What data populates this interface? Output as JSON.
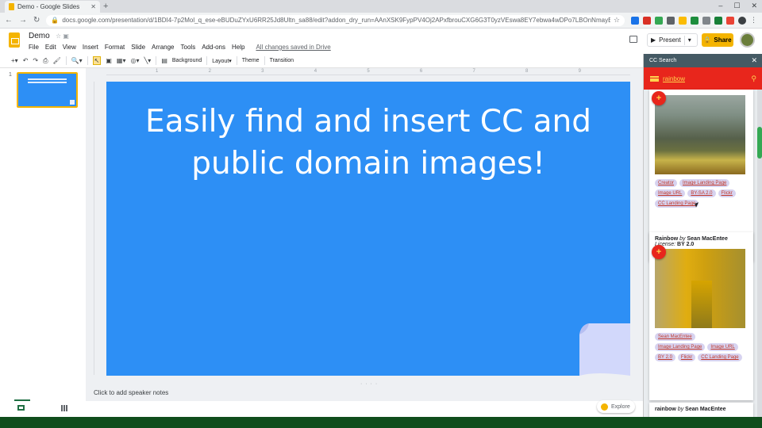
{
  "browser": {
    "tab_title": "Demo - Google Slides",
    "url": "docs.google.com/presentation/d/1BDI4-7p2Mol_q_ese-eBUDuZYxU6RR25Jd8Ultn_sa88/edit?addon_dry_run=AAnXSK9FypPV4Oj2APxfbrouCXG6G3T0yzVEswa8EY7ebwa4wDPo7LBOnNmayBCvLIZ7FHPKqeP3kGbRm..."
  },
  "app": {
    "doc_title": "Demo",
    "menu": [
      "File",
      "Edit",
      "View",
      "Insert",
      "Format",
      "Slide",
      "Arrange",
      "Tools",
      "Add-ons",
      "Help"
    ],
    "saved_status": "All changes saved in Drive",
    "present_label": "Present",
    "share_label": "Share"
  },
  "toolbar": {
    "background_label": "Background",
    "layout_label": "Layout▾",
    "theme_label": "Theme",
    "transition_label": "Transition"
  },
  "filmstrip": {
    "slide_number": "1"
  },
  "slide": {
    "title_line1": "Easily find and insert CC and",
    "title_line2": "public domain images!"
  },
  "notes_placeholder": "Click to add speaker notes",
  "explore_label": "Explore",
  "cc_search": {
    "header_title": "CC Search",
    "query": "rainbow",
    "cards": [
      {
        "chips": [
          "Creator",
          "Image Landing Page",
          "Image URL",
          "BY-SA 2.0",
          "Flickr",
          "CC Landing Page"
        ]
      },
      {
        "title": "Rainbow",
        "by": "by",
        "author": "Sean MacEntee",
        "license_label": "License:",
        "license": "BY 2.0",
        "chips": [
          "Sean MacEntee",
          "Image Landing Page",
          "Image URL",
          "BY 2.0",
          "Flickr",
          "CC Landing Page"
        ]
      },
      {
        "title": "rainbow",
        "by": "by",
        "author": "Sean MacEntee"
      }
    ]
  },
  "colors": {
    "slide_bg": "#2d8ff5",
    "cc_search_red": "#e8261c",
    "share_yellow": "#f4b400",
    "sidebar_header": "#455a64"
  }
}
